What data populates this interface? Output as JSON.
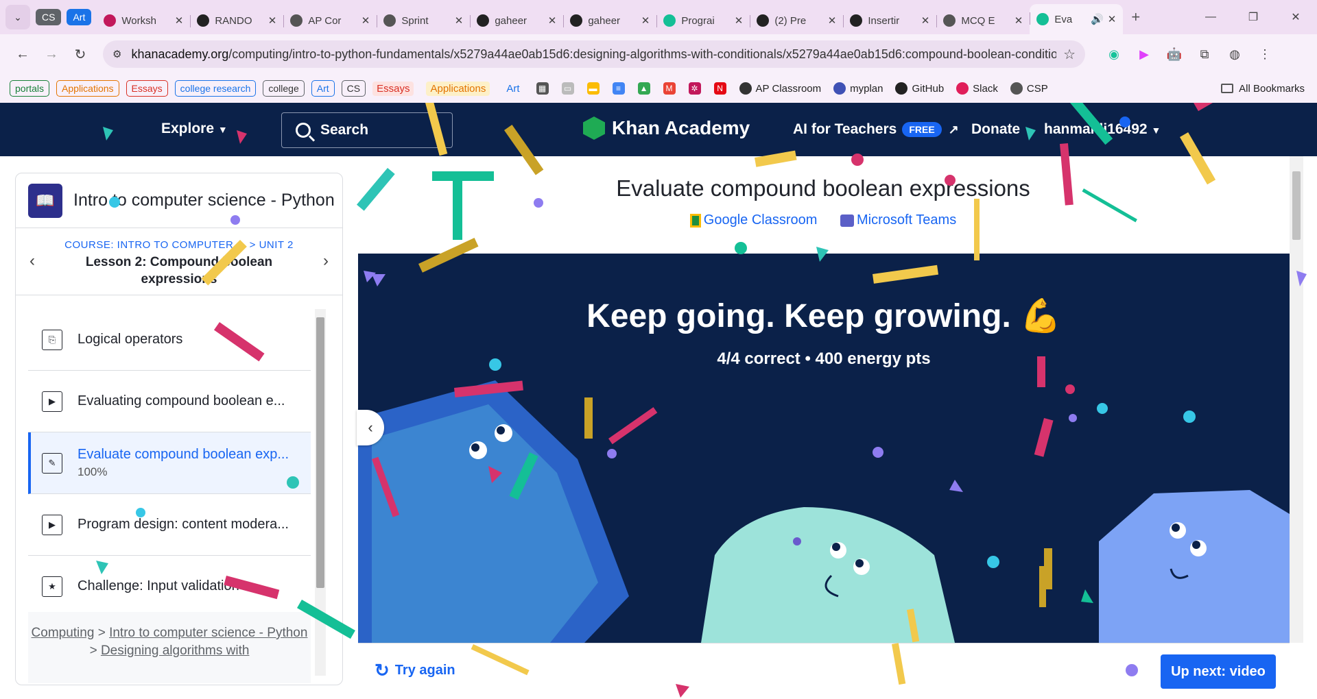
{
  "browser": {
    "tab_groups": [
      {
        "label": "CS",
        "color": "#5f6368"
      },
      {
        "label": "Art",
        "color": "#1a73e8"
      }
    ],
    "tabs": [
      {
        "title": "Worksh",
        "icon": "gear-icon",
        "color": "#c2185b"
      },
      {
        "title": "RANDO",
        "icon": "r-icon",
        "color": "#222222"
      },
      {
        "title": "AP Cor",
        "icon": "globe-icon",
        "color": "#555555"
      },
      {
        "title": "Sprint",
        "icon": "tool-icon",
        "color": "#555555"
      },
      {
        "title": "gaheer",
        "icon": "github-icon",
        "color": "#222222"
      },
      {
        "title": "gaheer",
        "icon": "github-icon",
        "color": "#222222"
      },
      {
        "title": "Prograi",
        "icon": "khan-icon",
        "color": "#14bf96"
      },
      {
        "title": "(2) Pre",
        "icon": "github-icon",
        "color": "#222222"
      },
      {
        "title": "Insertir",
        "icon": "openai-icon",
        "color": "#222222"
      },
      {
        "title": "MCQ E",
        "icon": "globe-icon",
        "color": "#555555"
      },
      {
        "title": "Eva",
        "icon": "khan-icon",
        "color": "#14bf96",
        "active": true
      }
    ],
    "new_tab": "+",
    "url_domain": "khanacademy.org",
    "url_path": "/computing/intro-to-python-fundamentals/x5279a44ae0ab15d6:designing-algorithms-with-conditionals/x5279a44ae0ab15d6:compound-boolean-condition...",
    "bookmarks_chips": [
      {
        "label": "portals",
        "color": "#188038"
      },
      {
        "label": "Applications",
        "color": "#e37400"
      },
      {
        "label": "Essays",
        "color": "#d93025"
      },
      {
        "label": "college research",
        "color": "#1a73e8"
      },
      {
        "label": "college",
        "color": "#5f6368"
      },
      {
        "label": "Art",
        "color": "#1a73e8"
      },
      {
        "label": "CS",
        "color": "#5f6368"
      }
    ],
    "bookmarks_plain": [
      {
        "label": "Essays",
        "color": "#d93025"
      },
      {
        "label": "Applications",
        "color": "#e37400"
      },
      {
        "label": "Art",
        "color": "#1a73e8"
      }
    ],
    "bookmark_links": [
      {
        "label": "AP Classroom",
        "icon": "globe-icon"
      },
      {
        "label": "myplan",
        "icon": "myplan-icon"
      },
      {
        "label": "GitHub",
        "icon": "github-icon"
      },
      {
        "label": "Slack",
        "icon": "slack-icon"
      },
      {
        "label": "CSP",
        "icon": "tool-icon"
      }
    ],
    "all_bookmarks": "All Bookmarks"
  },
  "header": {
    "explore": "Explore",
    "search": "Search",
    "logo": "Khan Academy",
    "ai_for_teachers": "AI for Teachers",
    "free_badge": "FREE",
    "donate": "Donate",
    "username": "hanmahli16492"
  },
  "sidebar": {
    "course_title": "Intro to computer science - Python",
    "crumb": "COURSE: INTRO TO COMPUTER ... > UNIT 2",
    "lesson": "Lesson 2: Compound boolean expressions",
    "items": [
      {
        "label": "Logical operators",
        "icon": "article-icon"
      },
      {
        "label": "Evaluating compound boolean e...",
        "icon": "video-icon"
      },
      {
        "label": "Evaluate compound boolean exp...",
        "sub": "100%",
        "icon": "exercise-icon",
        "active": true
      },
      {
        "label": "Program design: content modera...",
        "icon": "video-icon"
      },
      {
        "label": "Challenge: Input validation",
        "icon": "star-icon"
      }
    ],
    "breadcrumb": [
      "Computing",
      "Intro to computer science - Python",
      "Designing algorithms with"
    ]
  },
  "content": {
    "title": "Evaluate compound boolean expressions",
    "google_classroom": "Google Classroom",
    "microsoft_teams": "Microsoft Teams",
    "headline": "Keep going. Keep growing.",
    "emoji": "💪",
    "score": "4/4 correct • 400 energy pts",
    "try_again": "Try again",
    "up_next": "Up next: video"
  },
  "colors": {
    "header_bg": "#0b2149",
    "accent": "#1865f2",
    "khan_green": "#1fab54"
  }
}
